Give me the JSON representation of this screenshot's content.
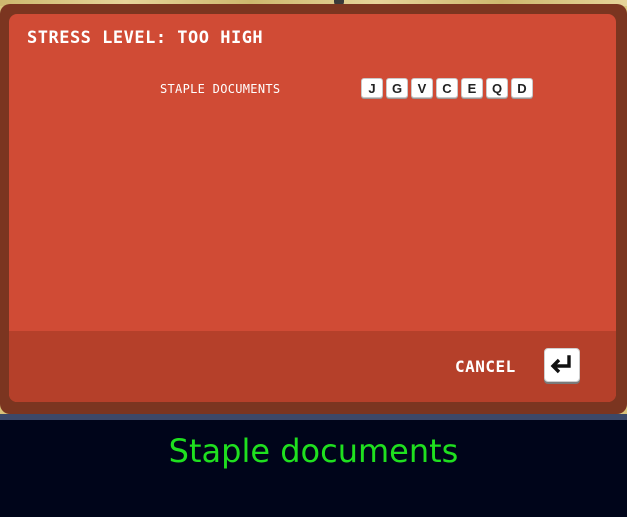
{
  "modal": {
    "title": "STRESS LEVEL: TOO HIGH",
    "task": {
      "label": "STAPLE DOCUMENTS",
      "keys": [
        "J",
        "G",
        "V",
        "C",
        "E",
        "Q",
        "D"
      ]
    },
    "footer": {
      "cancel_label": "CANCEL",
      "enter_icon": "return-arrow-icon"
    }
  },
  "caption": {
    "text": "Staple documents"
  },
  "colors": {
    "panel": "#d04b35",
    "frame": "#7b3520",
    "footer": "#b5402a",
    "caption_bg": "#00051a",
    "caption_text": "#1fe01f"
  }
}
